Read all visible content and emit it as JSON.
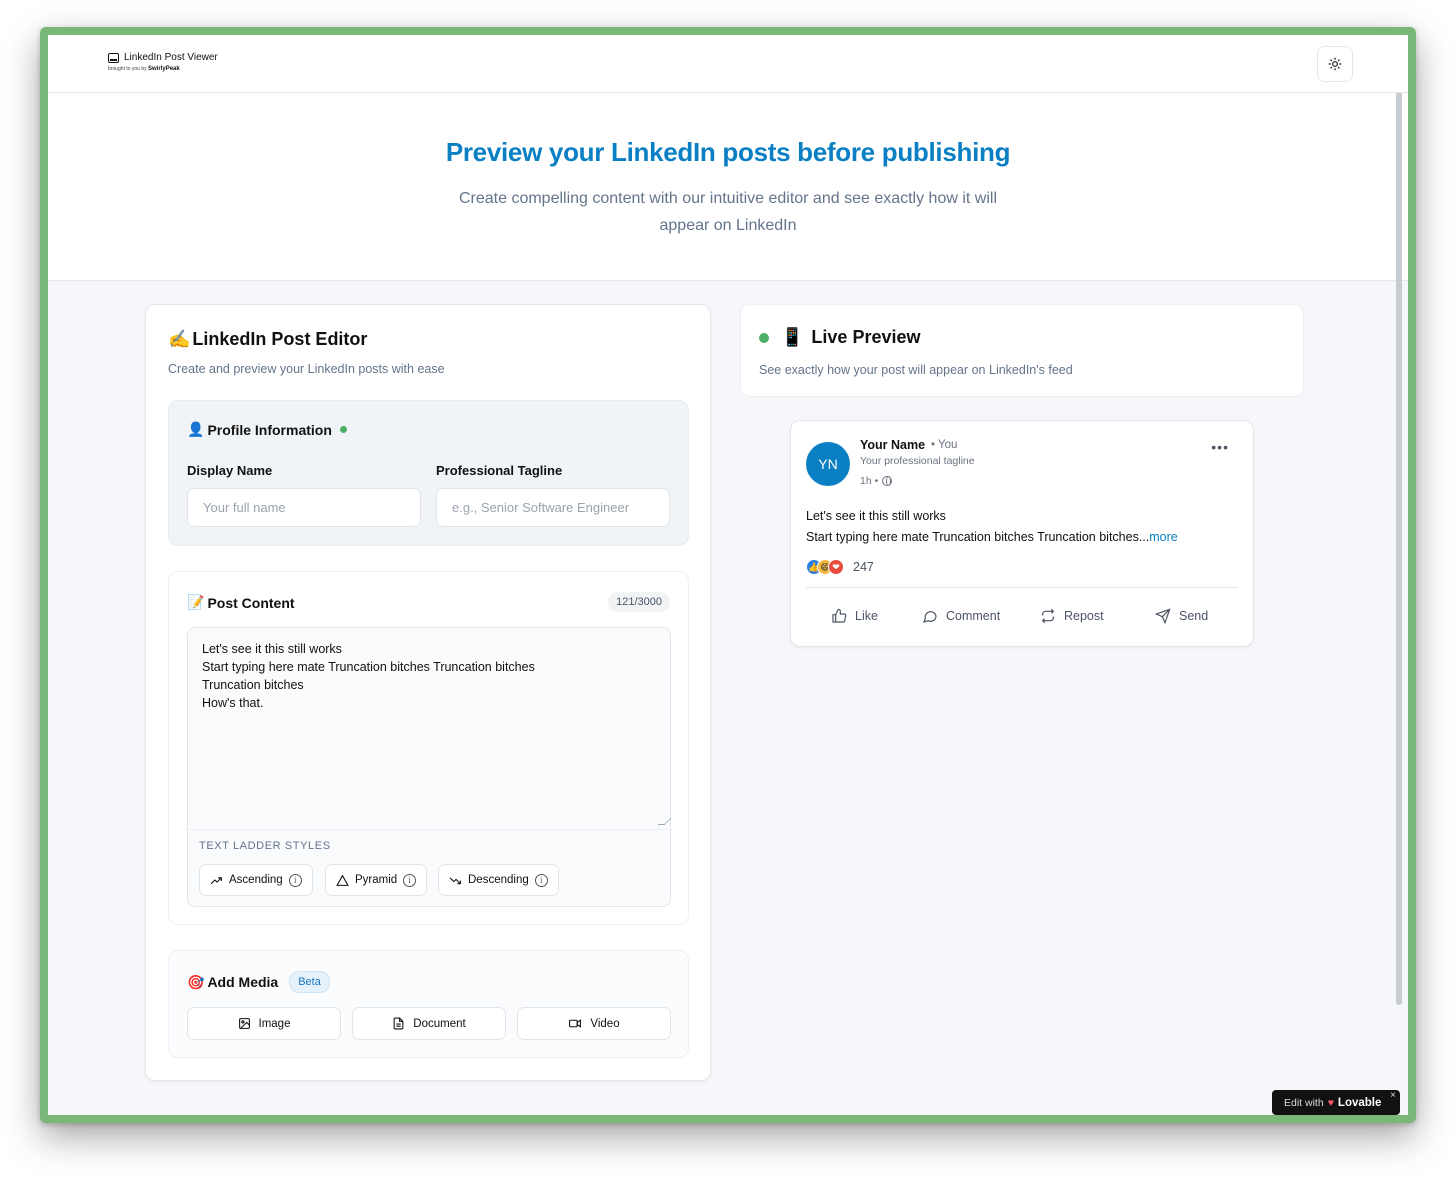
{
  "header": {
    "brand_title": "LinkedIn Post Viewer",
    "brand_sub_prefix": "brought to you by",
    "brand_sub_name": "SwirlyPeak",
    "theme_toggle_icon": "sun-icon"
  },
  "hero": {
    "title": "Preview your LinkedIn posts before publishing",
    "subtitle": "Create compelling content with our intuitive editor and see exactly how it will appear on LinkedIn"
  },
  "editor": {
    "title_emoji": "✍️",
    "title": "LinkedIn Post Editor",
    "subtitle": "Create and preview your LinkedIn posts with ease",
    "profile": {
      "title_emoji": "👤",
      "title": "Profile Information",
      "display_name_label": "Display Name",
      "display_name_placeholder": "Your full name",
      "display_name_value": "",
      "tagline_label": "Professional Tagline",
      "tagline_placeholder": "e.g., Senior Software Engineer",
      "tagline_value": ""
    },
    "post": {
      "title_emoji": "📝",
      "title": "Post Content",
      "counter": "121/3000",
      "content": "Let's see it this still works\nStart typing here mate Truncation bitches Truncation bitches\nTruncation bitches\nHow's that.",
      "ladder_label": "TEXT LADDER STYLES",
      "ladder_buttons": [
        "Ascending",
        "Pyramid",
        "Descending"
      ]
    },
    "media": {
      "title_emoji": "🎯",
      "title": "Add Media",
      "badge": "Beta",
      "buttons": [
        "Image",
        "Document",
        "Video"
      ]
    }
  },
  "preview": {
    "title_emoji": "📱",
    "title": "Live Preview",
    "subtitle": "See exactly how your post will appear on LinkedIn's feed",
    "status_color": "#4caf64"
  },
  "li_post": {
    "avatar_initials": "YN",
    "name": "Your Name",
    "you_label": "• You",
    "tagline": "Your professional tagline",
    "time": "1h •",
    "line1": "Let's see it this still works",
    "line2": "Start typing here mate Truncation bitches Truncation bitches...",
    "more": "more",
    "reaction_count": "247",
    "actions": [
      "Like",
      "Comment",
      "Repost",
      "Send"
    ]
  },
  "lovable": {
    "prefix": "Edit with",
    "name": "Lovable",
    "close": "×"
  },
  "colors": {
    "accent": "#0a7fc4",
    "window_frame": "#7ab87a",
    "status_green": "#4caf64"
  }
}
